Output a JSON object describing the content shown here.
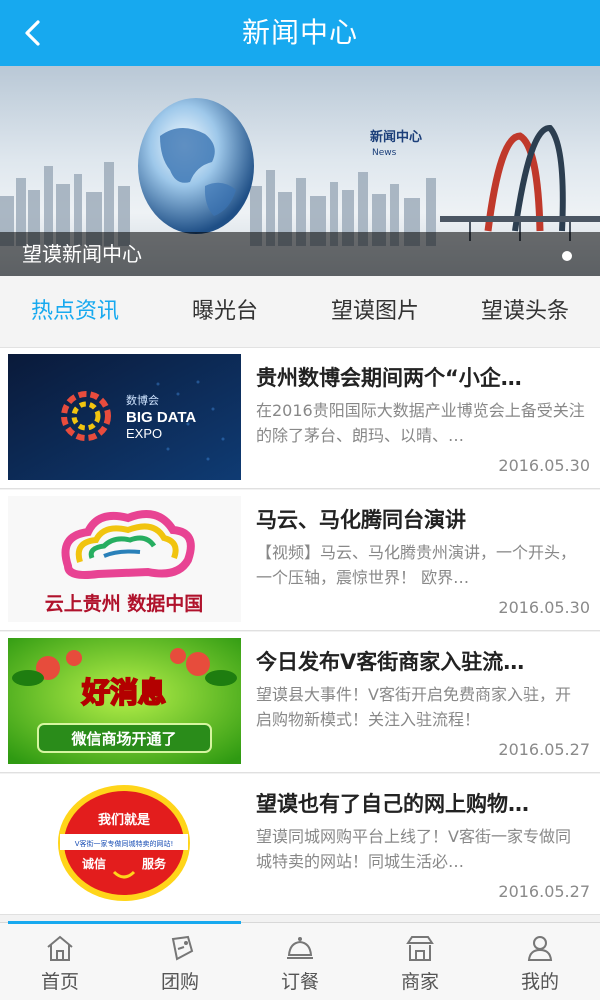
{
  "header": {
    "title": "新闻中心"
  },
  "banner": {
    "caption": "望谟新闻中心",
    "overlay_title": "新闻中心",
    "overlay_sub": "News"
  },
  "tabs": [
    {
      "label": "热点资讯",
      "active": true
    },
    {
      "label": "曝光台",
      "active": false
    },
    {
      "label": "望谟图片",
      "active": false
    },
    {
      "label": "望谟头条",
      "active": false
    }
  ],
  "news": [
    {
      "title": "贵州数博会期间两个“小企…",
      "desc": "在2016贵阳国际大数据产业博览会上备受关注的除了茅台、朗玛、以晴、…",
      "date": "2016.05.30",
      "thumb_text": [
        "数博会",
        "BIG DATA",
        "EXPO"
      ]
    },
    {
      "title": "马云、马化腾同台演讲",
      "desc": "【视频】马云、马化腾贵州演讲，一个开头，一个压轴，震惊世界！ 欧界…",
      "date": "2016.05.30",
      "thumb_text": [
        "云上贵州 数据中国"
      ]
    },
    {
      "title": "今日发布V客街商家入驻流…",
      "desc": "望谟县大事件！V客街开启免费商家入驻，开启购物新模式！关注入驻流程！",
      "date": "2016.05.27",
      "thumb_text": [
        "好消息",
        "微信商场开通了"
      ]
    },
    {
      "title": "望谟也有了自己的网上购物…",
      "desc": "望谟同城网购平台上线了！V客街一家专做同城特卖的网站！同城生活必…",
      "date": "2016.05.27",
      "thumb_text": [
        "我们就是",
        "V客街一家专做同城特卖的网站!",
        "诚信",
        "服务"
      ]
    }
  ],
  "bottom_nav": [
    {
      "label": "首页",
      "icon": "home-icon"
    },
    {
      "label": "团购",
      "icon": "coupon-icon"
    },
    {
      "label": "订餐",
      "icon": "dining-bell-icon"
    },
    {
      "label": "商家",
      "icon": "store-icon"
    },
    {
      "label": "我的",
      "icon": "user-icon"
    }
  ],
  "colors": {
    "accent": "#17a9ef",
    "text": "#222222",
    "muted": "#888888"
  }
}
